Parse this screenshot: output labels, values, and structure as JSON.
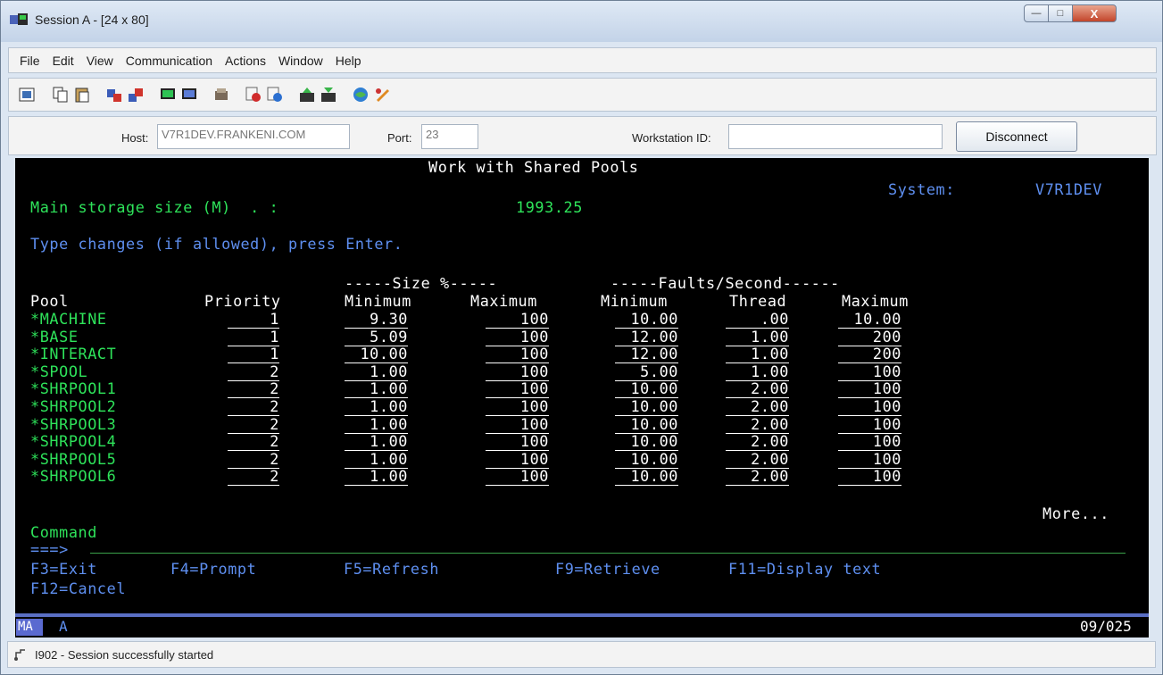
{
  "window": {
    "title": "Session A - [24 x 80]"
  },
  "menu": [
    "File",
    "Edit",
    "View",
    "Communication",
    "Actions",
    "Window",
    "Help"
  ],
  "connection": {
    "host_label": "Host:",
    "host_value": "V7R1DEV.FRANKENI.COM",
    "port_label": "Port:",
    "port_value": "23",
    "workstation_label": "Workstation ID:",
    "workstation_value": "",
    "disconnect_label": "Disconnect"
  },
  "terminal": {
    "screen_title": "Work with Shared Pools",
    "system_label": "System:",
    "system_value": "V7R1DEV",
    "main_storage_label": "Main storage size (M)  . :",
    "main_storage_value": "1993.25",
    "instruction": "Type changes (if allowed), press Enter.",
    "size_group": "-----Size %-----",
    "faults_group": "-----Faults/Second------",
    "headers": [
      "Pool",
      "Priority",
      "Minimum",
      "Maximum",
      "Minimum",
      "Thread",
      "Maximum"
    ],
    "rows": [
      {
        "pool": "*MACHINE",
        "priority": "1",
        "size_min": "9.30",
        "size_max": "100",
        "fault_min": "10.00",
        "thread": ".00",
        "fault_max": "10.00"
      },
      {
        "pool": "*BASE",
        "priority": "1",
        "size_min": "5.09",
        "size_max": "100",
        "fault_min": "12.00",
        "thread": "1.00",
        "fault_max": "200"
      },
      {
        "pool": "*INTERACT",
        "priority": "1",
        "size_min": "10.00",
        "size_max": "100",
        "fault_min": "12.00",
        "thread": "1.00",
        "fault_max": "200"
      },
      {
        "pool": "*SPOOL",
        "priority": "2",
        "size_min": "1.00",
        "size_max": "100",
        "fault_min": "5.00",
        "thread": "1.00",
        "fault_max": "100"
      },
      {
        "pool": "*SHRPOOL1",
        "priority": "2",
        "size_min": "1.00",
        "size_max": "100",
        "fault_min": "10.00",
        "thread": "2.00",
        "fault_max": "100"
      },
      {
        "pool": "*SHRPOOL2",
        "priority": "2",
        "size_min": "1.00",
        "size_max": "100",
        "fault_min": "10.00",
        "thread": "2.00",
        "fault_max": "100"
      },
      {
        "pool": "*SHRPOOL3",
        "priority": "2",
        "size_min": "1.00",
        "size_max": "100",
        "fault_min": "10.00",
        "thread": "2.00",
        "fault_max": "100"
      },
      {
        "pool": "*SHRPOOL4",
        "priority": "2",
        "size_min": "1.00",
        "size_max": "100",
        "fault_min": "10.00",
        "thread": "2.00",
        "fault_max": "100"
      },
      {
        "pool": "*SHRPOOL5",
        "priority": "2",
        "size_min": "1.00",
        "size_max": "100",
        "fault_min": "10.00",
        "thread": "2.00",
        "fault_max": "100"
      },
      {
        "pool": "*SHRPOOL6",
        "priority": "2",
        "size_min": "1.00",
        "size_max": "100",
        "fault_min": "10.00",
        "thread": "2.00",
        "fault_max": "100"
      }
    ],
    "more": "More...",
    "command_label": "Command",
    "command_prompt": "===>",
    "fkeys_line1": [
      "F3=Exit",
      "F4=Prompt",
      "F5=Refresh",
      "F9=Retrieve",
      "F11=Display text"
    ],
    "fkeys_line2": [
      "F12=Cancel"
    ]
  },
  "oia": {
    "indicator": "MA",
    "mode": "A",
    "cursor": "09/025"
  },
  "statusbar": {
    "message": "I902 - Session successfully started"
  }
}
